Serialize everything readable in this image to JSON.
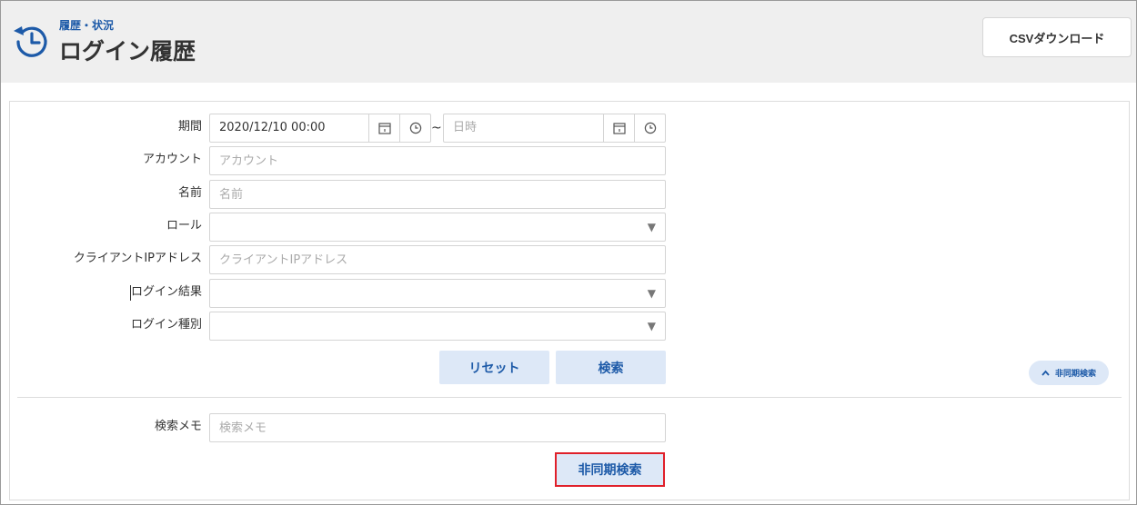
{
  "header": {
    "breadcrumb": "履歴・状況",
    "title": "ログイン履歴",
    "csv_button": "CSVダウンロード",
    "icon": "history-icon",
    "accent_color": "#1d5aa8"
  },
  "form": {
    "period": {
      "label": "期間",
      "start_value": "2020/12/10 00:00",
      "separator": "~",
      "end_placeholder": "日時"
    },
    "account": {
      "label": "アカウント",
      "placeholder": "アカウント"
    },
    "name": {
      "label": "名前",
      "placeholder": "名前"
    },
    "role": {
      "label": "ロール",
      "value": ""
    },
    "client_ip": {
      "label": "クライアントIPアドレス",
      "placeholder": "クライアントIPアドレス"
    },
    "login_result": {
      "label": "ログイン結果",
      "value": ""
    },
    "login_type": {
      "label": "ログイン種別",
      "value": ""
    },
    "reset_button": "リセット",
    "search_button": "検索",
    "async_toggle": "非同期検索"
  },
  "async_section": {
    "memo": {
      "label": "検索メモ",
      "placeholder": "検索メモ"
    },
    "async_search_button": "非同期検索",
    "highlight_color": "#e0202a"
  }
}
